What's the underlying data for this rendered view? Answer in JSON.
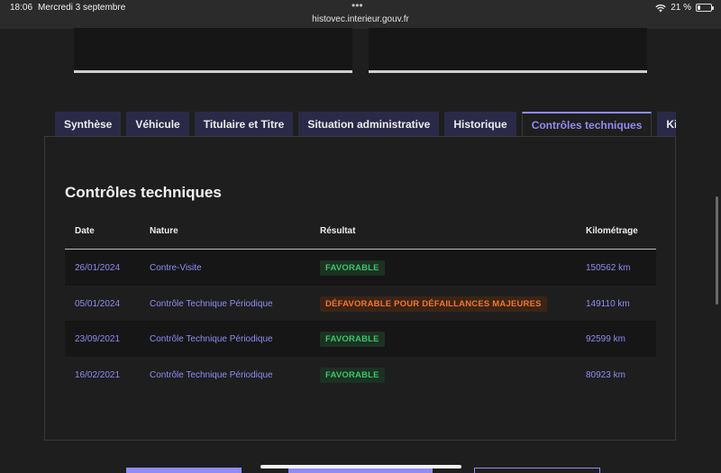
{
  "status": {
    "time": "18:06",
    "date": "Mercredi 3 septembre",
    "dots": "•••",
    "url": "histovec.interieur.gouv.fr",
    "battery_text": "21 %",
    "battery_level": 0.21
  },
  "tabs": [
    {
      "label": "Synthèse"
    },
    {
      "label": "Véhicule"
    },
    {
      "label": "Titulaire et Titre"
    },
    {
      "label": "Situation administrative"
    },
    {
      "label": "Historique"
    },
    {
      "label": "Contrôles techniques"
    },
    {
      "label": "Kilo"
    }
  ],
  "active_tab": "Contrôles techniques",
  "section": {
    "title": "Contrôles techniques",
    "headers": {
      "date": "Date",
      "nature": "Nature",
      "result": "Résultat",
      "km": "Kilométrage"
    },
    "rows": [
      {
        "date": "26/01/2024",
        "nature": "Contre-Visite",
        "result": "FAVORABLE",
        "status": "ok",
        "km": "150562 km"
      },
      {
        "date": "05/01/2024",
        "nature": "Contrôle Technique Périodique",
        "result": "DÉFAVORABLE POUR DÉFAILLANCES MAJEURES",
        "status": "ko",
        "km": "149110 km"
      },
      {
        "date": "23/09/2021",
        "nature": "Contrôle Technique Périodique",
        "result": "FAVORABLE",
        "status": "ok",
        "km": "92599 km"
      },
      {
        "date": "16/02/2021",
        "nature": "Contrôle Technique Périodique",
        "result": "FAVORABLE",
        "status": "ok",
        "km": "80923 km"
      }
    ]
  },
  "colors": {
    "accent": "#8f8cf3",
    "favorable": "#3ec36a",
    "defavorable": "#f0762f",
    "tab_bg": "#2a2a48"
  }
}
